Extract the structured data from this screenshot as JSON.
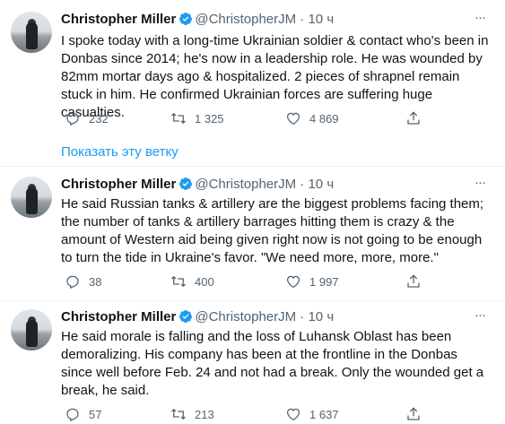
{
  "tweets": [
    {
      "name": "Christopher Miller",
      "handle": "@ChristopherJM",
      "separator": "·",
      "time": "10 ч",
      "text": "I spoke today with a long-time Ukrainian soldier & contact who's been in Donbas since 2014; he's now in a leadership role. He was wounded by 82mm mortar days ago & hospitalized. 2 pieces of shrapnel remain stuck in him. He confirmed Ukrainian forces are suffering huge casualties.",
      "replies": "232",
      "retweets": "1 325",
      "likes": "4 869"
    },
    {
      "name": "Christopher Miller",
      "handle": "@ChristopherJM",
      "separator": "·",
      "time": "10 ч",
      "text": "He said Russian tanks & artillery are the biggest problems facing them; the number of tanks & artillery barrages hitting them is crazy & the amount of Western aid being given right now is not going to be enough to turn the tide in Ukraine's favor. \"We need more, more, more.\"",
      "replies": "38",
      "retweets": "400",
      "likes": "1 997"
    },
    {
      "name": "Christopher Miller",
      "handle": "@ChristopherJM",
      "separator": "·",
      "time": "10 ч",
      "text": "He said morale is falling and the loss of Luhansk Oblast has been demoralizing. His company has been at the frontline in the Donbas since well before Feb. 24 and not had a break. Only the wounded get a break, he said.",
      "replies": "57",
      "retweets": "213",
      "likes": "1 637"
    }
  ],
  "show_thread": "Показать эту ветку",
  "icons": {
    "verified": "verified-badge-icon",
    "more": "more-options-icon",
    "reply": "reply-icon",
    "retweet": "retweet-icon",
    "like": "heart-icon",
    "share": "share-icon"
  },
  "colors": {
    "accent": "#1d9bf0",
    "secondary_text": "#536471",
    "text": "#0f1419"
  }
}
